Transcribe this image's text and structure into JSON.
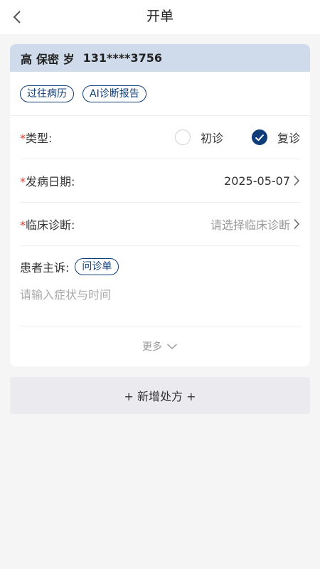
{
  "header": {
    "title": "开单",
    "back_icon": "chevron-left-icon"
  },
  "patient": {
    "name": "高",
    "age": "保密 岁",
    "phone": "131****3756"
  },
  "tags": [
    {
      "label": "过往病历"
    },
    {
      "label": "AI诊断报告"
    }
  ],
  "type_row": {
    "required_mark": "*",
    "label": "类型:",
    "options": [
      {
        "label": "初诊",
        "checked": false
      },
      {
        "label": "复诊",
        "checked": true
      }
    ]
  },
  "onset_row": {
    "required_mark": "*",
    "label": "发病日期:",
    "value": "2025-05-07"
  },
  "diagnosis_row": {
    "required_mark": "*",
    "label": "临床诊断:",
    "placeholder": "请选择临床诊断"
  },
  "complaint": {
    "label": "患者主诉:",
    "tag": "问诊单",
    "placeholder": "请输入症状与时间"
  },
  "more": {
    "label": "更多"
  },
  "add_prescription": {
    "label": "+ 新增处方 +"
  },
  "colors": {
    "primary": "#0d3c78",
    "patient_bar": "#cfdbea",
    "required": "#e23b2e",
    "background": "#f5f5f5"
  }
}
